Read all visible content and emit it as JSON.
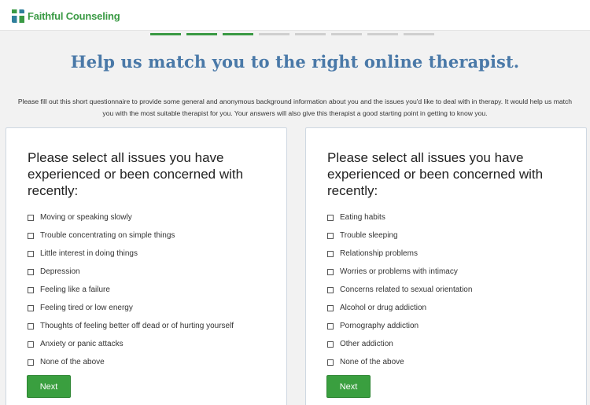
{
  "header": {
    "brand": "Faithful Counseling"
  },
  "progress": {
    "completed": 3,
    "total": 8
  },
  "headline": "Help us match you to the right online therapist.",
  "intro": {
    "line1": "Please fill out this short questionnaire to provide some general and anonymous background information about you and the issues you'd like to deal with in therapy. It would help us match",
    "line2": "you with the most suitable therapist for you. Your answers will also give this therapist a good starting point in getting to know you."
  },
  "colors": {
    "brand_green": "#3a9a44",
    "headline_blue": "#4a79a8",
    "button_green": "#3a9f3f"
  },
  "left_card": {
    "question": "Please select all issues you have experienced or been concerned with recently:",
    "options": [
      "Moving or speaking slowly",
      "Trouble concentrating on simple things",
      "Little interest in doing things",
      "Depression",
      "Feeling like a failure",
      "Feeling tired or low energy",
      "Thoughts of feeling better off dead or of hurting yourself",
      "Anxiety or panic attacks",
      "None of the above"
    ],
    "next_label": "Next"
  },
  "right_card": {
    "question": "Please select all issues you have experienced or been concerned with recently:",
    "options": [
      "Eating habits",
      "Trouble sleeping",
      "Relationship problems",
      "Worries or problems with intimacy",
      "Concerns related to sexual orientation",
      "Alcohol or drug addiction",
      "Pornography addiction",
      "Other addiction",
      "None of the above"
    ],
    "next_label": "Next"
  }
}
